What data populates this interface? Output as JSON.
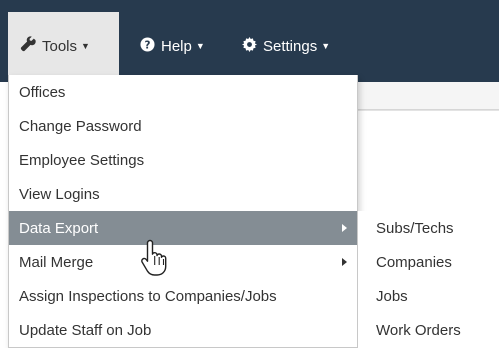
{
  "navbar": {
    "tools": {
      "label": "Tools",
      "icon": "wrench-icon"
    },
    "help": {
      "label": "Help",
      "icon": "question-circle-icon"
    },
    "settings": {
      "label": "Settings",
      "icon": "gear-icon"
    },
    "caret": "▼"
  },
  "tools_menu": {
    "items": [
      {
        "label": "Offices"
      },
      {
        "label": "Change Password"
      },
      {
        "label": "Employee Settings"
      },
      {
        "label": "View Logins"
      },
      {
        "label": "Data Export",
        "highlighted": true,
        "has_submenu": true
      },
      {
        "label": "Mail Merge",
        "has_submenu": true
      },
      {
        "label": "Assign Inspections to Companies/Jobs"
      },
      {
        "label": "Update Staff on Job"
      }
    ]
  },
  "data_export_submenu": {
    "items": [
      {
        "label": "Subs/Techs"
      },
      {
        "label": "Companies"
      },
      {
        "label": "Jobs"
      },
      {
        "label": "Work Orders"
      }
    ]
  },
  "colors": {
    "navbar_bg": "#273a4e",
    "active_nav_bg": "#e7e7e7",
    "highlight_bg": "#848d94",
    "text": "#333333"
  },
  "cursor": {
    "icon": "hand-pointer-icon"
  }
}
